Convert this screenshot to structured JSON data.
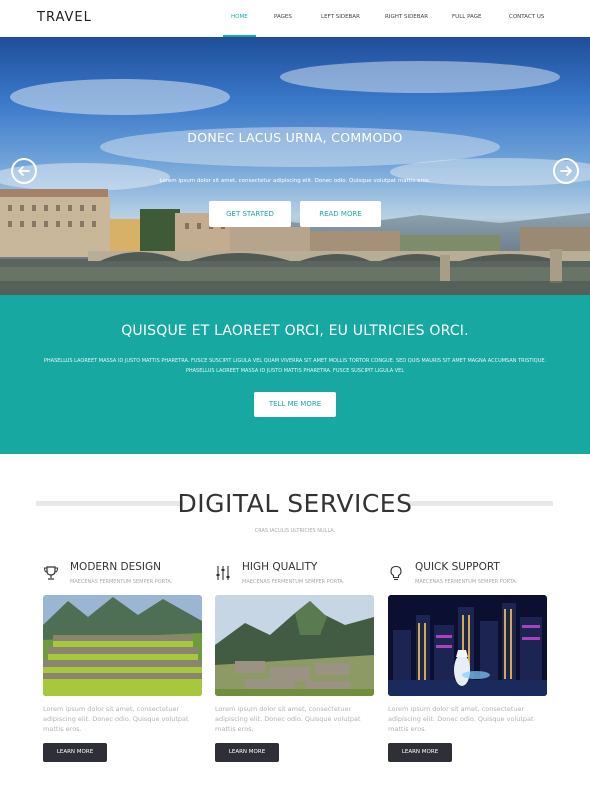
{
  "nav": {
    "logo": "TRAVEL",
    "items": [
      {
        "label": "HOME",
        "active": true
      },
      {
        "label": "PAGES",
        "active": false
      },
      {
        "label": "LEFT SIDEBAR",
        "active": false
      },
      {
        "label": "RIGHT SIDEBAR",
        "active": false
      },
      {
        "label": "FULL PAGE",
        "active": false
      },
      {
        "label": "CONTACT US",
        "active": false
      }
    ]
  },
  "hero": {
    "title": "DONEC LACUS URNA, COMMODO",
    "subtitle": "Lorem ipsum dolor sit amet, consectetur adipiscing elit. Donec odio. Quisque volutpat mattis eros.",
    "primary_button": "GET STARTED",
    "secondary_button": "READ MORE",
    "prev_icon": "arrow-left-circle-icon",
    "next_icon": "arrow-right-circle-icon"
  },
  "band": {
    "title": "QUISQUE ET LAOREET ORCI, EU ULTRICIES ORCI.",
    "text": "Phasellus laoreet massa id justo mattis pharetra. Fusce suscipit ligula vel quam viverra sit amet mollis tortor congue. Sed quis mauris sit amet magna accumsan tristique. Phasellus laoreet massa id justo mattis pharetra. Fusce suscipit ligula vel",
    "button": "TELL ME MORE"
  },
  "services": {
    "title": "DIGITAL SERVICES",
    "subtitle": "Cras iaculis ultricies nulla.",
    "cards": [
      {
        "icon": "trophy-icon",
        "title": "MODERN DESIGN",
        "subtitle": "Maecenas fermentum semper porta.",
        "text": "Lorem ipsum dolor sit amet, consectetuer adipiscing elit. Donec odio. Quisque volutpat mattis eros.",
        "button": "LEARN MORE"
      },
      {
        "icon": "sliders-icon",
        "title": "HIGH QUALITY",
        "subtitle": "Maecenas fermentum semper porta.",
        "text": "Lorem ipsum dolor sit amet, consectetuer adipiscing elit. Donec odio. Quisque volutpat mattis eros.",
        "button": "LEARN MORE"
      },
      {
        "icon": "lightbulb-icon",
        "title": "QUICK SUPPORT",
        "subtitle": "Maecenas fermentum semper porta.",
        "text": "Lorem ipsum dolor sit amet, consectetuer adipiscing elit. Donec odio. Quisque volutpat mattis eros.",
        "button": "LEARN MORE"
      }
    ]
  },
  "colors": {
    "accent": "#1aa8a2",
    "dark_button": "#2f2f38"
  }
}
